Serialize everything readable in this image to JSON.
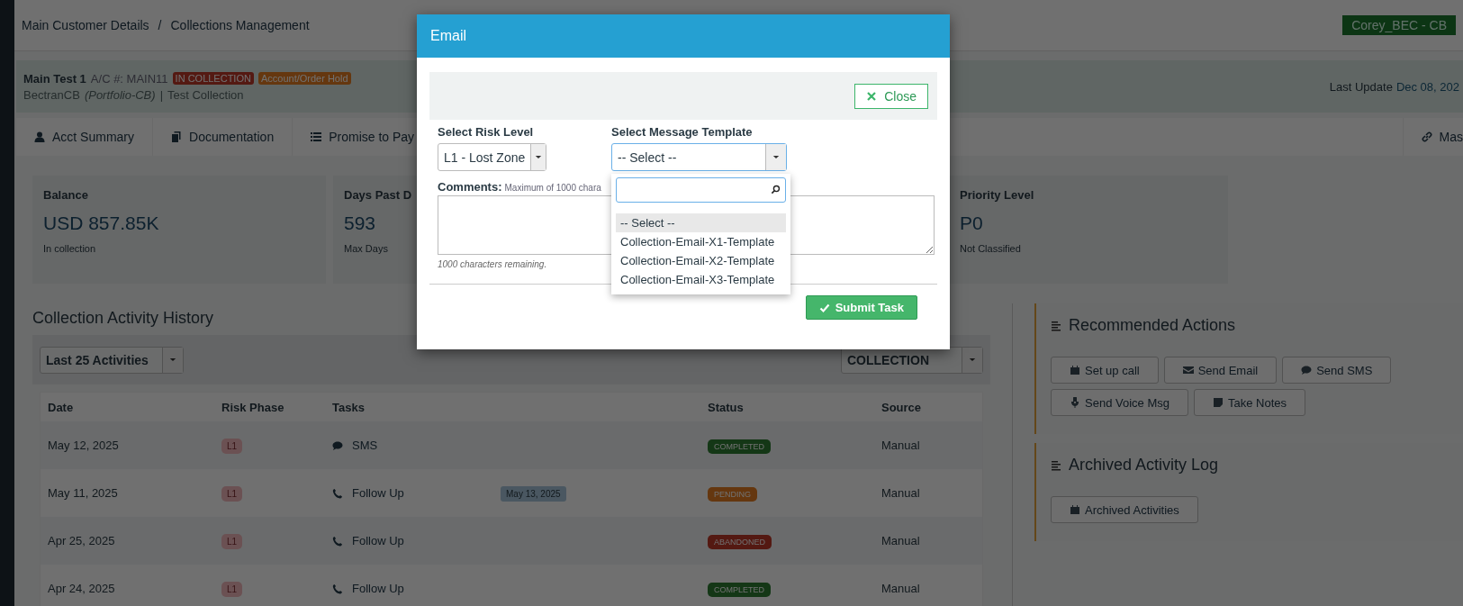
{
  "header": {
    "breadcrumbs": [
      "Main Customer Details",
      "Collections Management"
    ],
    "separator": "/",
    "user_badge": "Corey_BEC - CB"
  },
  "account": {
    "name": "Main Test 1",
    "account_number": "A/C #: MAIN11",
    "tags": [
      {
        "label": "IN COLLECTION",
        "kind": "collection"
      },
      {
        "label": "Account/Order Hold",
        "kind": "hold"
      }
    ],
    "company": "BectranCB",
    "portfolio": "(Portfolio-CB)",
    "divider": "|",
    "collection": "Test Collection",
    "last_update_label": "Last Update",
    "last_update_value": "Dec 08, 202"
  },
  "tabs": [
    {
      "label": "Acct Summary"
    },
    {
      "label": "Documentation"
    },
    {
      "label": "Promise to Pay"
    },
    {
      "label": "Mas"
    }
  ],
  "stats": [
    {
      "title": "Balance",
      "value": "USD 857.85K",
      "note": "In collection"
    },
    {
      "title": "Days Past D",
      "value": "593",
      "note": "Max Days"
    },
    {
      "title": "Priority Level",
      "value": "P0",
      "note": "Not Classified"
    }
  ],
  "activity": {
    "title": "Collection Activity History",
    "range_filter": "Last 25 Activities",
    "phase_filter": "COLLECTION",
    "columns": [
      "Date",
      "Risk Phase",
      "Tasks",
      "Status",
      "Source"
    ],
    "rows": [
      {
        "date": "May 12, 2025",
        "risk_phase": "L1",
        "task": {
          "kind": "sms",
          "label": "SMS"
        },
        "status": {
          "kind": "completed",
          "label": "COMPLETED"
        },
        "source": "Manual"
      },
      {
        "date": "May 11, 2025",
        "risk_phase": "L1",
        "task": {
          "kind": "call",
          "label": "Follow Up"
        },
        "due": "May 13, 2025",
        "status": {
          "kind": "pending",
          "label": "PENDING"
        },
        "source": "Manual"
      },
      {
        "date": "Apr 25, 2025",
        "risk_phase": "L1",
        "task": {
          "kind": "call",
          "label": "Follow Up"
        },
        "status": {
          "kind": "abandoned",
          "label": "ABANDONED"
        },
        "source": "Manual"
      },
      {
        "date": "Apr 24, 2025",
        "risk_phase": "L1",
        "task": {
          "kind": "call",
          "label": "Follow Up"
        },
        "status": {
          "kind": "completed",
          "label": "COMPLETED"
        },
        "source": "Manual"
      }
    ]
  },
  "recommended": {
    "title": "Recommended Actions",
    "actions": [
      "Set up call",
      "Send Email",
      "Send SMS",
      "Send Voice Msg",
      "Take Notes"
    ]
  },
  "archived": {
    "title": "Archived Activity Log",
    "actions": [
      "Archived Activities"
    ]
  },
  "modal": {
    "title": "Email",
    "close_button": "Close",
    "risk_level": {
      "label": "Select Risk Level",
      "value": "L1 - Lost Zone"
    },
    "template": {
      "label": "Select Message Template",
      "value": "-- Select --",
      "expanded": true,
      "options": [
        {
          "label": "-- Select --",
          "selected": true
        },
        {
          "label": "Collection-Email-X1-Template",
          "selected": false
        },
        {
          "label": "Collection-Email-X2-Template",
          "selected": false
        },
        {
          "label": "Collection-Email-X3-Template",
          "selected": false
        }
      ]
    },
    "comments": {
      "label": "Comments:",
      "hint": "Maximum of 1000 chara",
      "remaining": "1000 characters remaining."
    },
    "submit_button": "Submit Task"
  }
}
